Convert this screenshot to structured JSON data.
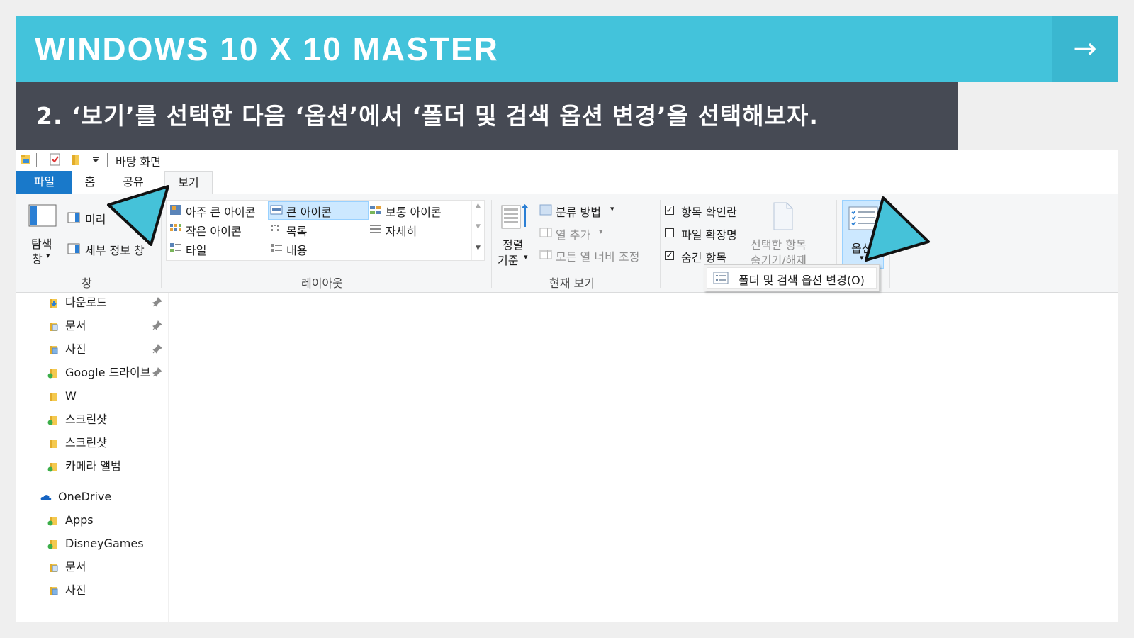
{
  "slide": {
    "title": "WINDOWS 10 X 10 MASTER",
    "next_arrow": "→",
    "step_text": "2. ‘보기’를 선택한 다음 ‘옵션’에서 ‘폴더 및 검색 옵션 변경’을 선택해보자."
  },
  "window": {
    "title": "바탕 화면"
  },
  "tabs": {
    "file": "파일",
    "home": "홈",
    "share": "공유",
    "view": "보기"
  },
  "ribbon": {
    "pane_group": {
      "nav_pane_line1": "탐색",
      "nav_pane_line2": "창",
      "preview": "미리",
      "details_pane": "세부 정보 창",
      "label": "창"
    },
    "layout_group": {
      "items": [
        "아주 큰 아이콘",
        "큰 아이콘",
        "보통 아이콘",
        "작은 아이콘",
        "목록",
        "자세히",
        "타일",
        "내용"
      ],
      "selected": "큰 아이콘",
      "label": "레이아웃"
    },
    "current_view_group": {
      "sort_line1": "정렬",
      "sort_line2": "기준",
      "group_by": "분류 방법",
      "add_columns": "열 추가",
      "size_all_columns": "모든 열 너비 조정",
      "label": "현재 보기"
    },
    "show_hide_group": {
      "item_checkboxes": "항목 확인란",
      "item_checkboxes_checked": true,
      "file_extensions": "파일 확장명",
      "file_extensions_checked": false,
      "hidden_items": "숨긴 항목",
      "hidden_items_checked": true,
      "hide_selected_line1": "선택한 항목",
      "hide_selected_line2": "숨기기/해제"
    },
    "options": {
      "label": "옵션"
    }
  },
  "dropdown": {
    "change_folder_options": "폴더 및 검색 옵션 변경(O)"
  },
  "nav_pane": {
    "quick_access": [
      {
        "label": "다운로드",
        "pinned": true
      },
      {
        "label": "문서",
        "pinned": true
      },
      {
        "label": "사진",
        "pinned": true
      },
      {
        "label": "Google 드라이브",
        "pinned": true
      },
      {
        "label": "W",
        "pinned": false
      },
      {
        "label": "스크린샷",
        "pinned": false
      },
      {
        "label": "스크린샷",
        "pinned": false
      },
      {
        "label": "카메라 앨범",
        "pinned": false
      }
    ],
    "onedrive": {
      "label": "OneDrive",
      "children": [
        "Apps",
        "DisneyGames",
        "문서",
        "사진"
      ]
    }
  },
  "colors": {
    "title_bar": "#43c3db",
    "step_bar": "#464a54",
    "file_tab": "#1979ca",
    "pointer": "#45c2d9",
    "selection": "#cce8ff"
  }
}
